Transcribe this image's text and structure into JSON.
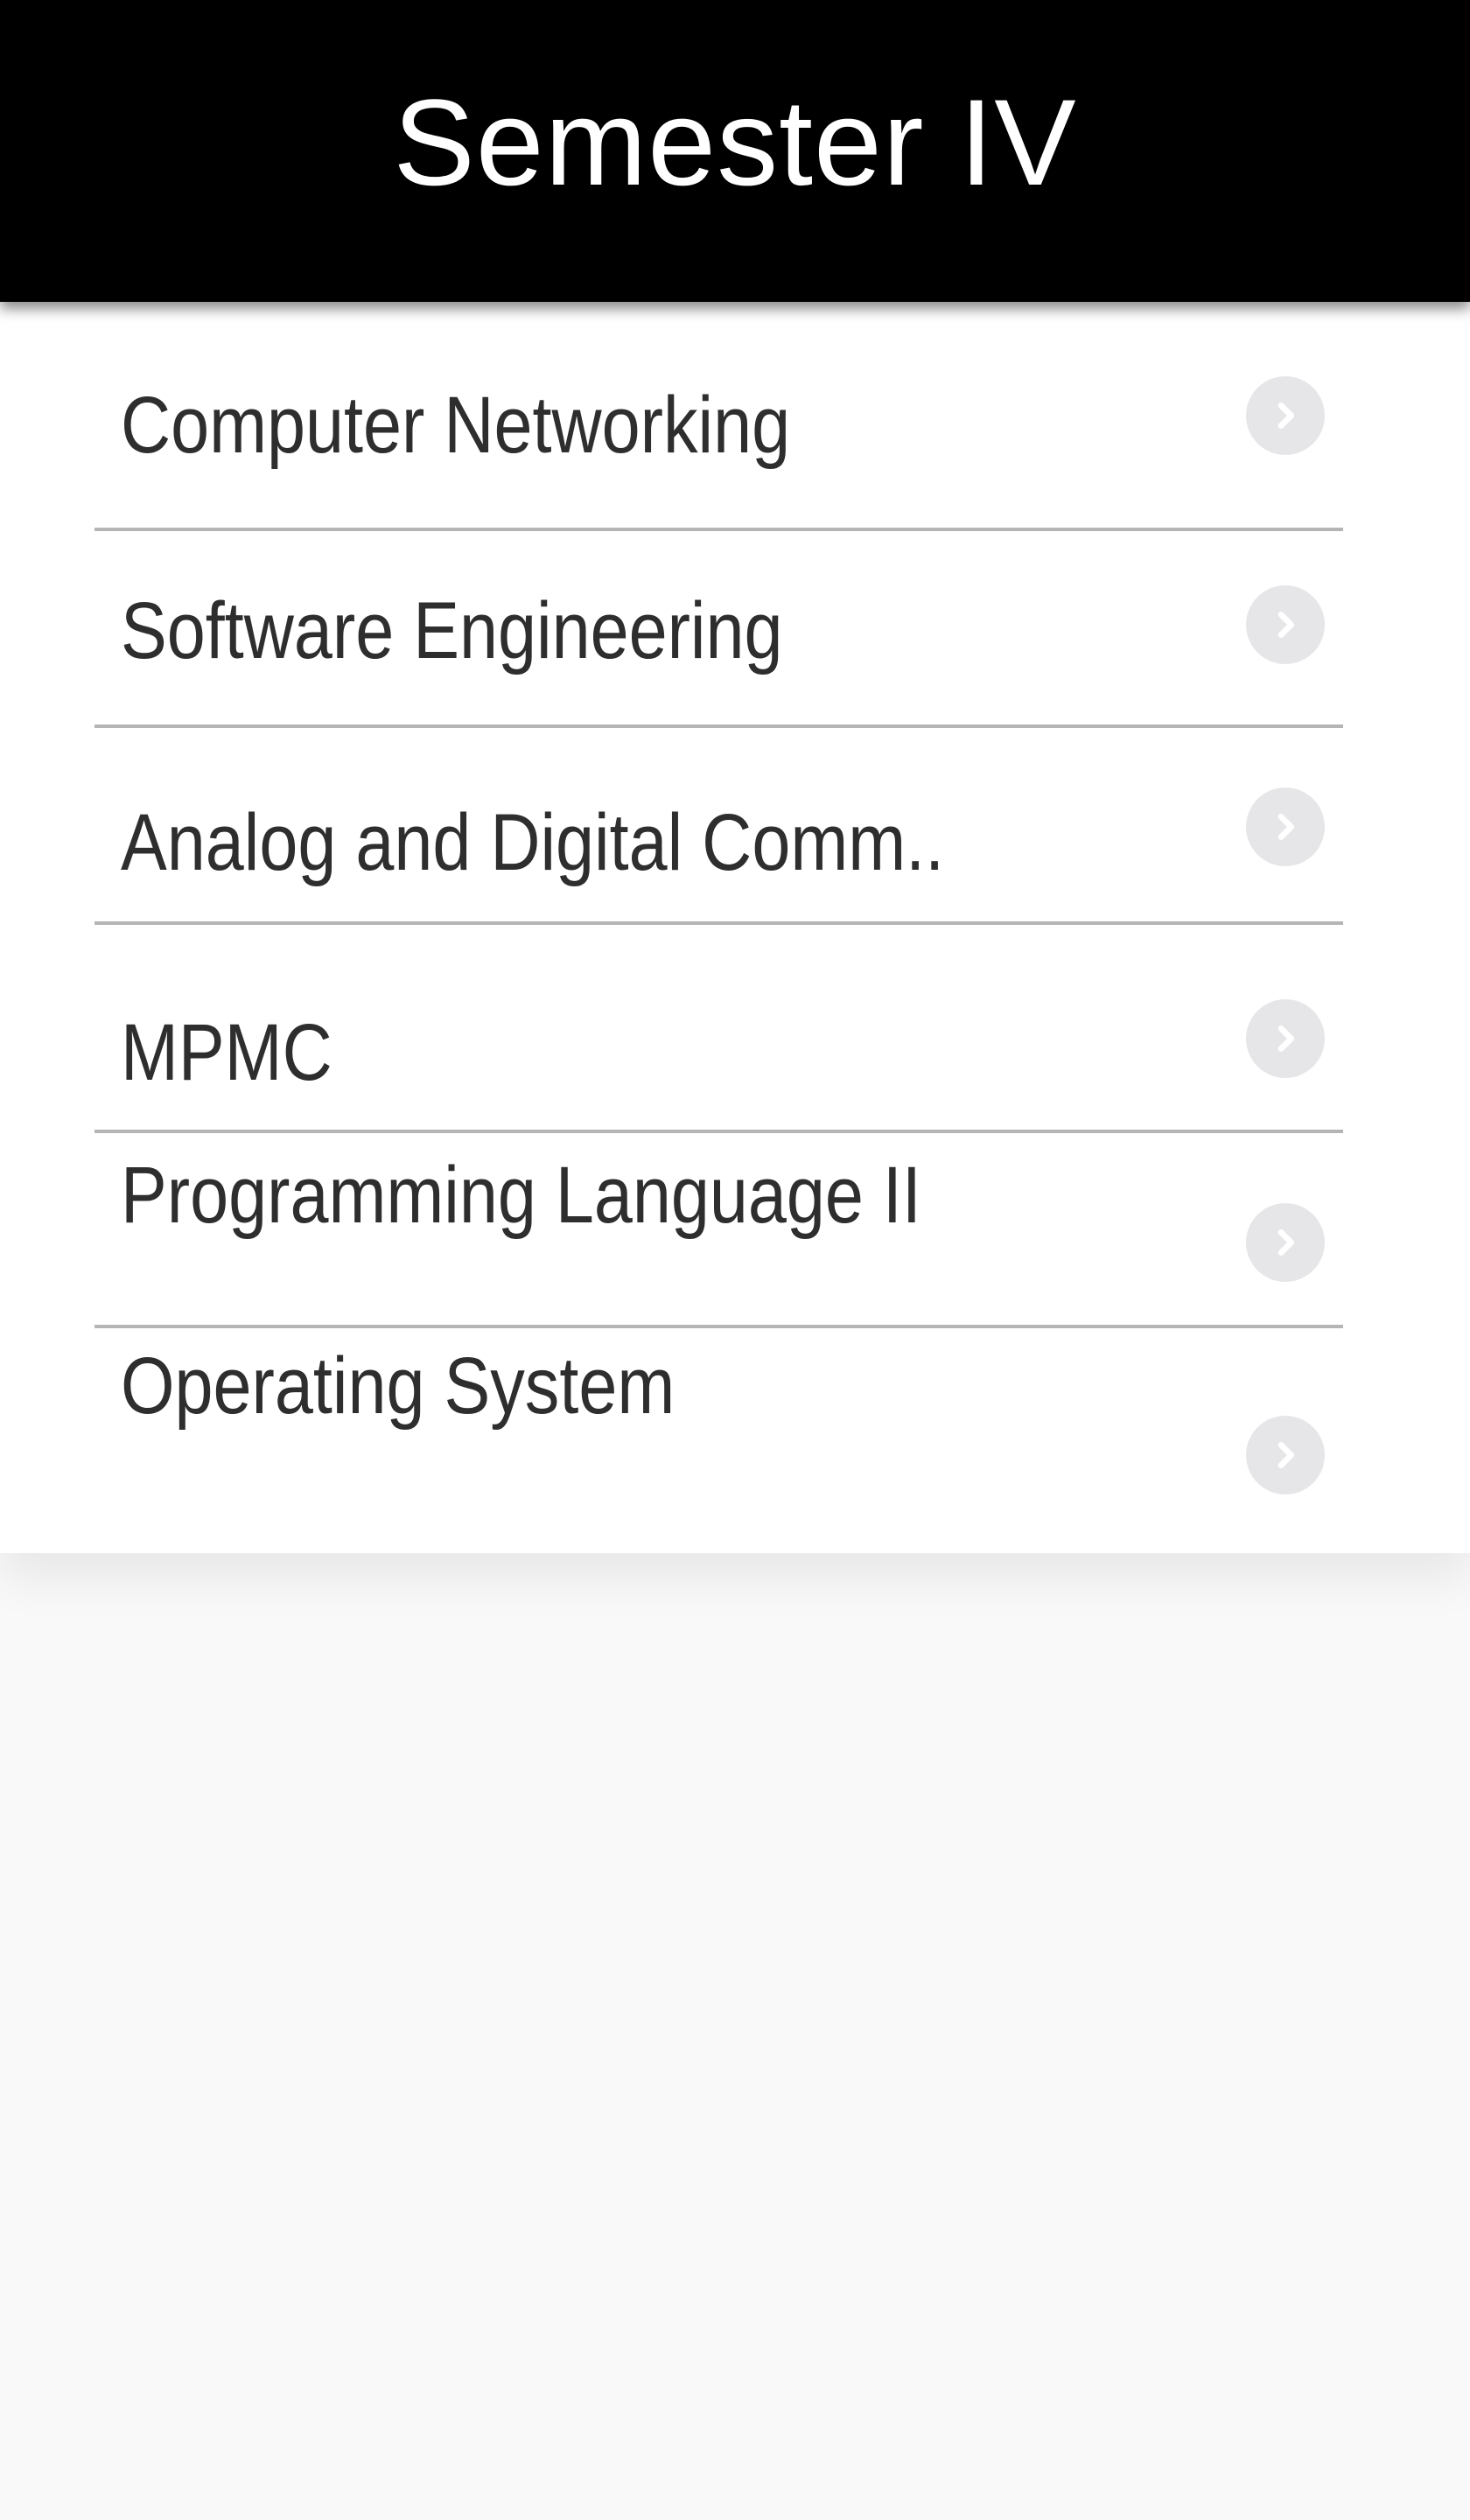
{
  "header": {
    "title": "Semester IV"
  },
  "subjects": [
    {
      "label": "Computer Networking",
      "icon": "chevron-right-icon"
    },
    {
      "label": "Software Engineering",
      "icon": "chevron-right-icon"
    },
    {
      "label": "Analog and Digital Comm..",
      "icon": "chevron-right-icon"
    },
    {
      "label": "MPMC",
      "icon": "chevron-right-icon"
    },
    {
      "label": "Programming Language II",
      "icon": "chevron-right-icon"
    },
    {
      "label": "Operating System",
      "icon": "chevron-right-icon"
    }
  ],
  "colors": {
    "header_bg": "#000000",
    "header_text": "#ffffff",
    "item_text": "#2e2e2e",
    "divider": "#b5b5b5",
    "chevron_circle": "#e6e6e9",
    "page_bg": "#f9f9f9"
  }
}
